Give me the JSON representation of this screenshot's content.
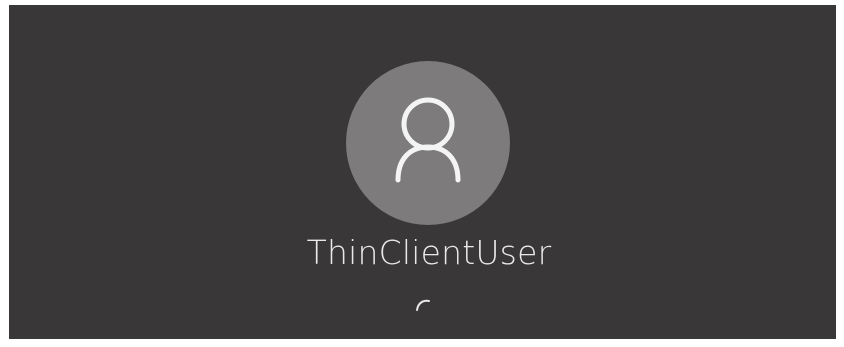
{
  "signin": {
    "username": "ThinClientUser",
    "avatar_icon": "user-icon",
    "status_icon": "loading-spinner-icon"
  },
  "colors": {
    "background": "#3a3738",
    "avatar_circle": "#7d7b7c",
    "text": "#e9e9e9"
  }
}
